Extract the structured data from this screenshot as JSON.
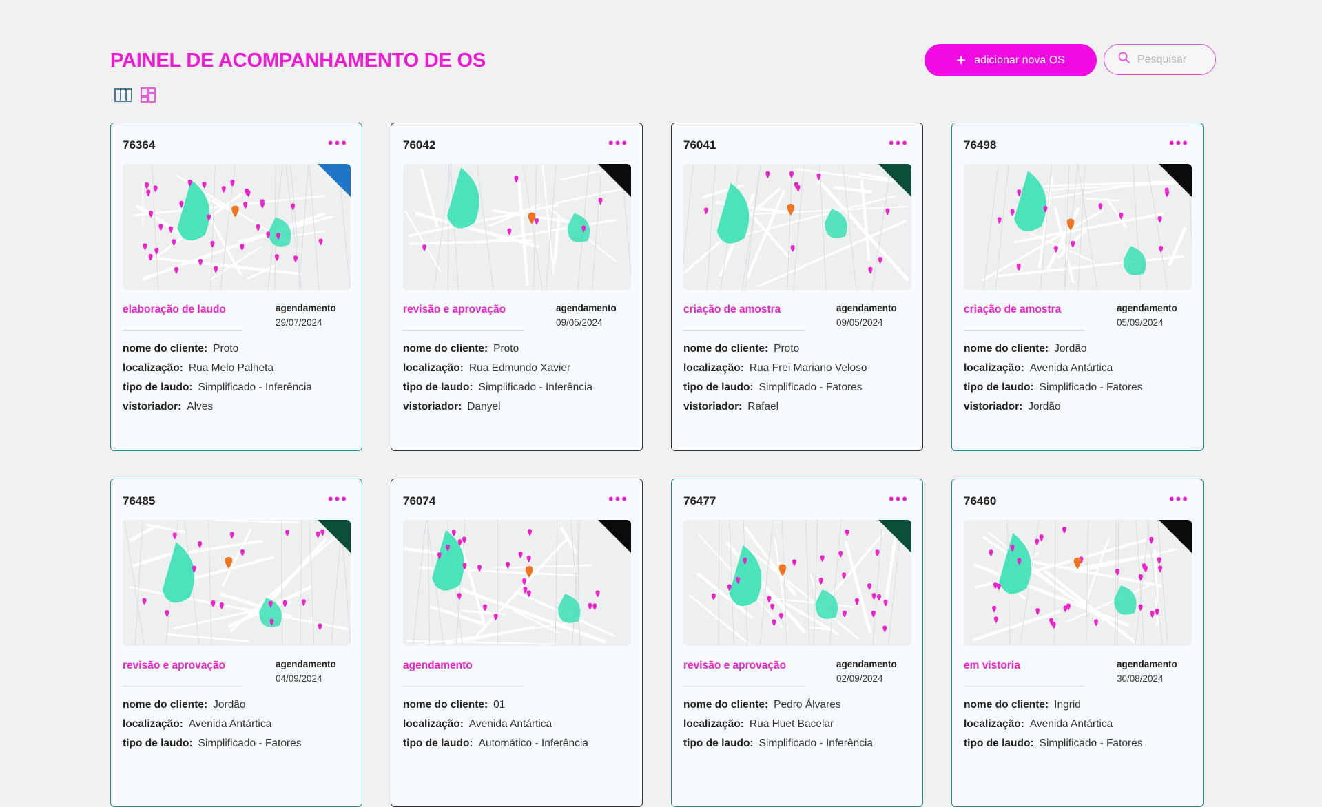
{
  "header": {
    "title": "PAINEL DE ACOMPANHAMENTO DE OS",
    "add_label": "adicionar nova OS",
    "search_placeholder": "Pesquisar"
  },
  "colors": {
    "accent": "#f00be5",
    "teal_border": "#1f8a8a",
    "dark_border": "#333333"
  },
  "labels": {
    "agendamento": "agendamento",
    "cliente": "nome do cliente:",
    "localizacao": "localização:",
    "tipo": "tipo de laudo:",
    "vistoriador": "vistoriador:"
  },
  "cards": [
    {
      "id": "76364",
      "status": "elaboração de laudo",
      "agendamento": "agendamento",
      "date": "29/07/2024",
      "cliente": "Proto",
      "local": "Rua Melo Palheta",
      "tipo": "Simplificado - Inferência",
      "vistoriador": "Alves"
    },
    {
      "id": "76042",
      "status": "revisão e aprovação",
      "agendamento": "agendamento",
      "date": "09/05/2024",
      "cliente": "Proto",
      "local": "Rua Edmundo Xavier",
      "tipo": "Simplificado - Inferência",
      "vistoriador": "Danyel"
    },
    {
      "id": "76041",
      "status": "criação de amostra",
      "agendamento": "agendamento",
      "date": "09/05/2024",
      "cliente": "Proto",
      "local": "Rua Frei Mariano Veloso",
      "tipo": "Simplificado - Fatores",
      "vistoriador": "Rafael"
    },
    {
      "id": "76498",
      "status": "criação de amostra",
      "agendamento": "agendamento",
      "date": "05/09/2024",
      "cliente": "Jordão",
      "local": "Avenida Antártica",
      "tipo": "Simplificado - Fatores",
      "vistoriador": "Jordão"
    },
    {
      "id": "76485",
      "status": "revisão e aprovação",
      "agendamento": "agendamento",
      "date": "04/09/2024",
      "cliente": "Jordão",
      "local": "Avenida Antártica",
      "tipo": "Simplificado - Fatores",
      "vistoriador": ""
    },
    {
      "id": "76074",
      "status": "agendamento",
      "agendamento": "",
      "date": "",
      "cliente": "01",
      "local": "Avenida Antártica",
      "tipo": "Automático - Inferência",
      "vistoriador": ""
    },
    {
      "id": "76477",
      "status": "revisão e aprovação",
      "agendamento": "agendamento",
      "date": "02/09/2024",
      "cliente": "Pedro Álvares",
      "local": "Rua Huet Bacelar",
      "tipo": "Simplificado - Inferência",
      "vistoriador": ""
    },
    {
      "id": "76460",
      "status": "em vistoria",
      "agendamento": "agendamento",
      "date": "30/08/2024",
      "cliente": "Ingrid",
      "local": "Avenida Antártica",
      "tipo": "Simplificado - Fatores",
      "vistoriador": ""
    }
  ]
}
